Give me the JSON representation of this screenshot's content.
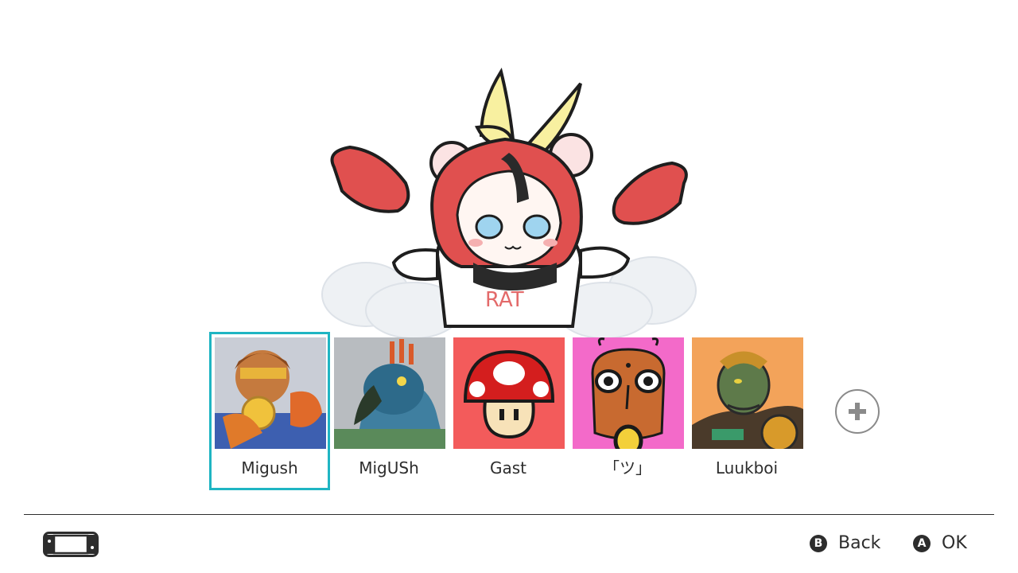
{
  "users": [
    {
      "name": "Migush",
      "selected": true,
      "icon": "brawler-avatar"
    },
    {
      "name": "MigUSh",
      "selected": false,
      "icon": "bird-warrior-avatar"
    },
    {
      "name": "Gast",
      "selected": false,
      "icon": "mushroom-avatar"
    },
    {
      "name": "｢ツ｣",
      "selected": false,
      "icon": "face-avatar"
    },
    {
      "name": "Luukboi",
      "selected": false,
      "icon": "armored-villain-avatar"
    }
  ],
  "footer": {
    "back_button": "B",
    "back_label": "Back",
    "ok_button": "A",
    "ok_label": "OK"
  },
  "colors": {
    "selection": "#1fb5c3",
    "text": "#2d2d2d"
  }
}
